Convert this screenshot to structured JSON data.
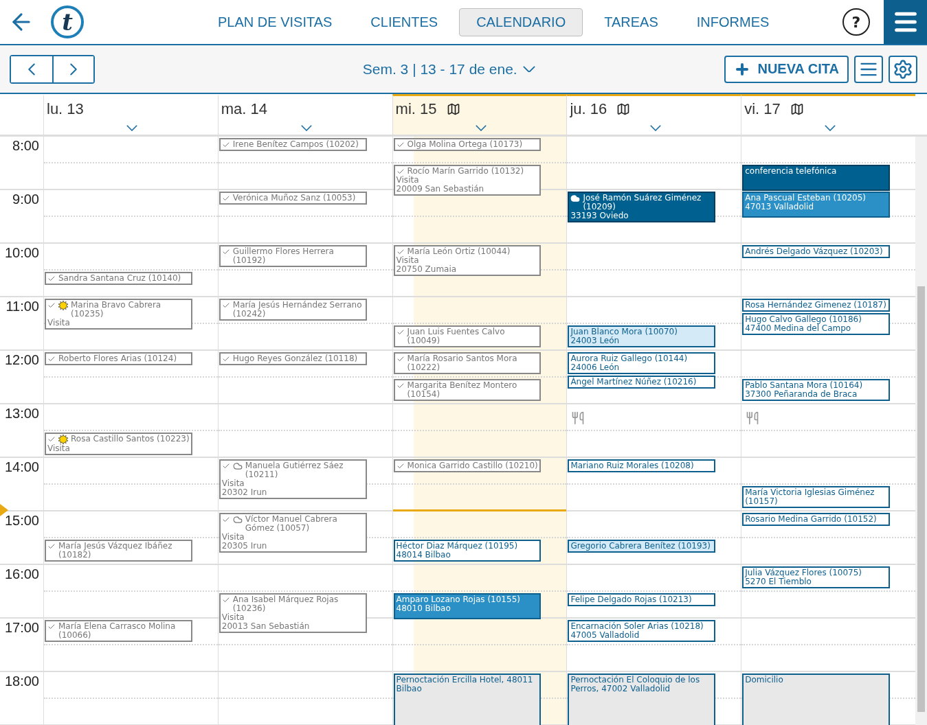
{
  "nav": {
    "logo": "t",
    "help": "?",
    "tabs": [
      {
        "label": "PLAN DE VISITAS",
        "selected": false
      },
      {
        "label": "CLIENTES",
        "selected": false
      },
      {
        "label": "CALENDARIO",
        "selected": true
      },
      {
        "label": "TAREAS",
        "selected": false
      },
      {
        "label": "INFORMES",
        "selected": false
      }
    ]
  },
  "toolbar": {
    "week": "Sem. 3 | 13 - 17 de ene.",
    "new_button": "NUEVA CITA"
  },
  "calendar": {
    "hours": [
      {
        "label": "8:00",
        "now": false
      },
      {
        "label": "9:00",
        "now": false
      },
      {
        "label": "10:00",
        "now": false
      },
      {
        "label": "11:00",
        "now": false
      },
      {
        "label": "12:00",
        "now": false
      },
      {
        "label": "13:00",
        "now": false
      },
      {
        "label": "14:00",
        "now": true
      },
      {
        "label": "15:00",
        "now": false
      },
      {
        "label": "16:00",
        "now": false
      },
      {
        "label": "17:00",
        "now": false
      },
      {
        "label": "18:00",
        "now": false
      }
    ],
    "days": [
      {
        "label": "lu. 13",
        "today": false,
        "marked": false,
        "slots": [
          {
            "now": false
          },
          {
            "now": false
          },
          {
            "now": false
          },
          {
            "now": false
          },
          {
            "now": false
          },
          {
            "now": false,
            "events": [
              {
                "kind": "done",
                "title": "Sandra Santana Cruz (10140)"
              }
            ]
          },
          {
            "now": false,
            "events": [
              {
                "kind": "done",
                "weather": {
                  "kind": "sun"
                },
                "title": "Marina Bravo Cabrera (10235)",
                "details": [
                  "Visita"
                ]
              }
            ]
          },
          {
            "now": false
          },
          {
            "now": false,
            "events": [
              {
                "kind": "done",
                "title": "Roberto Flores Arias (10124)"
              }
            ]
          },
          {
            "now": false
          },
          {
            "now": false
          },
          {
            "now": false,
            "events": [
              {
                "kind": "done",
                "weather": {
                  "kind": "sun"
                },
                "title": "Rosa Castillo Santos (10223)",
                "details": [
                  "Visita"
                ]
              }
            ]
          },
          {
            "now": false
          },
          {
            "now": false
          },
          {
            "now": false
          },
          {
            "now": false,
            "events": [
              {
                "kind": "done",
                "title": "María Jesús Vázquez Ibáñez (10182)"
              }
            ]
          },
          {
            "now": false
          },
          {
            "now": false
          },
          {
            "now": false,
            "events": [
              {
                "kind": "done",
                "title": "María Elena Carrasco Molina (10066)"
              }
            ]
          },
          {
            "now": false
          },
          {
            "now": false
          },
          {
            "now": false
          }
        ]
      },
      {
        "label": "ma. 14",
        "today": false,
        "marked": false,
        "slots": [
          {
            "now": false,
            "events": [
              {
                "kind": "done",
                "title": "Irene Benítez Campos (10202)"
              }
            ]
          },
          {
            "now": false
          },
          {
            "now": false,
            "events": [
              {
                "kind": "done",
                "title": "Verónica Muñoz Sanz (10053)"
              }
            ]
          },
          {
            "now": false
          },
          {
            "now": false,
            "events": [
              {
                "kind": "done",
                "title": "Guillermo Flores Herrera (10192)"
              }
            ]
          },
          {
            "now": false
          },
          {
            "now": false,
            "events": [
              {
                "kind": "done",
                "title": "María Jesús Hernández Serrano (10242)"
              }
            ]
          },
          {
            "now": false
          },
          {
            "now": false,
            "events": [
              {
                "kind": "done",
                "title": "Hugo Reyes González (10118)"
              }
            ]
          },
          {
            "now": false
          },
          {
            "now": false
          },
          {
            "now": false
          },
          {
            "now": false,
            "events": [
              {
                "kind": "done",
                "weather": {
                  "kind": "cloud"
                },
                "title": "Manuela Gutiérrez Sáez (10211)",
                "details": [
                  "Visita",
                  "20302 Irun"
                ]
              }
            ]
          },
          {
            "now": false
          },
          {
            "now": false,
            "events": [
              {
                "kind": "done",
                "weather": {
                  "kind": "cloud"
                },
                "title": "Víctor Manuel Cabrera Gómez (10057)",
                "details": [
                  "Visita",
                  "20305 Irun"
                ]
              }
            ]
          },
          {
            "now": false
          },
          {
            "now": false
          },
          {
            "now": false,
            "events": [
              {
                "kind": "done",
                "title": "Ana Isabel Márquez Rojas (10236)",
                "details": [
                  "Visita",
                  "20013 San Sebastián"
                ]
              }
            ]
          },
          {
            "now": false
          },
          {
            "now": false
          },
          {
            "now": false
          },
          {
            "now": false
          }
        ]
      },
      {
        "label": "mi. 15",
        "today": true,
        "marked": true,
        "slots": [
          {
            "now": false,
            "events": [
              {
                "kind": "done",
                "title": "Olga Molina Ortega (10173)"
              }
            ]
          },
          {
            "now": false,
            "events": [
              {
                "kind": "done",
                "title": "Rocío Marín Garrido (10132)",
                "details": [
                  "Visita",
                  "20009 San Sebastián"
                ]
              }
            ]
          },
          {
            "now": false
          },
          {
            "now": false
          },
          {
            "now": false,
            "events": [
              {
                "kind": "done",
                "title": "María León Ortiz (10044)",
                "details": [
                  "Visita",
                  "20750 Zumaia"
                ]
              }
            ]
          },
          {
            "now": false
          },
          {
            "now": false
          },
          {
            "now": false,
            "events": [
              {
                "kind": "done",
                "title": "Juan Luis Fuentes Calvo (10049)"
              }
            ]
          },
          {
            "now": false,
            "events": [
              {
                "kind": "done",
                "title": "María Rosario Santos Mora (10222)"
              }
            ]
          },
          {
            "now": false,
            "events": [
              {
                "kind": "done",
                "title": "Margarita Benítez Montero (10154)"
              }
            ]
          },
          {
            "now": false
          },
          {
            "now": false
          },
          {
            "now": false,
            "events": [
              {
                "kind": "done",
                "title": "Monica Garrido Castillo (10210)"
              }
            ]
          },
          {
            "now": true
          },
          {
            "now": false
          },
          {
            "now": false,
            "events": [
              {
                "kind": "open",
                "title": "Héctor Diaz Márquez (10195)",
                "details": [
                  "48014 Bilbao"
                ]
              }
            ]
          },
          {
            "now": false
          },
          {
            "now": false,
            "events": [
              {
                "kind": "confirmed",
                "title": "Amparo Lozano Rojas (10155)",
                "details": [
                  "48010 Bilbao"
                ]
              }
            ]
          },
          {
            "now": false
          },
          {
            "now": false
          },
          {
            "now": false,
            "events": [
              {
                "kind": "overnight",
                "title": "Pernoctación Ercilla Hotel, 48011 Bilbao"
              }
            ]
          },
          {
            "now": false
          }
        ]
      },
      {
        "label": "ju. 16",
        "today": false,
        "marked": true,
        "slots": [
          {
            "now": false
          },
          {
            "now": false
          },
          {
            "now": false,
            "events": [
              {
                "kind": "dark",
                "weather": {
                  "kind": "cloud"
                },
                "title": "José Ramón Suárez Giménez (10209)",
                "details": [
                  "33193 Oviedo"
                ]
              }
            ]
          },
          {
            "now": false
          },
          {
            "now": false
          },
          {
            "now": false
          },
          {
            "now": false
          },
          {
            "now": false,
            "events": [
              {
                "kind": "highlighted",
                "title": "Juan Blanco Mora (10070)",
                "details": [
                  "24003 León"
                ]
              }
            ]
          },
          {
            "now": false,
            "events": [
              {
                "kind": "open",
                "title": "Aurora Ruiz Gallego (10144)",
                "details": [
                  "24006 León"
                ]
              },
              {
                "kind": "open",
                "title": "Ángel Martínez Núñez (10216)"
              }
            ]
          },
          {
            "now": false
          },
          {
            "now": false,
            "events": [
              {
                "kind": "lunch"
              }
            ]
          },
          {
            "now": false
          },
          {
            "now": false,
            "events": [
              {
                "kind": "open",
                "title": "Mariano Ruiz Morales (10208)"
              }
            ]
          },
          {
            "now": false
          },
          {
            "now": false
          },
          {
            "now": false,
            "events": [
              {
                "kind": "highlighted",
                "title": "Gregorio Cabrera Benítez (10193)"
              }
            ]
          },
          {
            "now": false
          },
          {
            "now": false,
            "events": [
              {
                "kind": "open",
                "title": "Felipe Delgado Rojas (10213)"
              }
            ]
          },
          {
            "now": false,
            "events": [
              {
                "kind": "open",
                "title": "Encarnación Soler Arias (10218)",
                "details": [
                  "47005 Valladolid"
                ]
              }
            ]
          },
          {
            "now": false
          },
          {
            "now": false,
            "events": [
              {
                "kind": "overnight",
                "title": "Pernoctación El Coloquio de los Perros, 47002 Valladolid"
              }
            ]
          },
          {
            "now": false
          }
        ]
      },
      {
        "label": "vi. 17",
        "today": false,
        "marked": true,
        "slots": [
          {
            "now": false
          },
          {
            "now": false,
            "events": [
              {
                "kind": "dark",
                "title": "conferencia telefónica"
              }
            ]
          },
          {
            "now": false,
            "events": [
              {
                "kind": "confirmed",
                "title": "Ana Pascual Esteban (10205)",
                "details": [
                  "47013 Valladolid"
                ]
              }
            ]
          },
          {
            "now": false
          },
          {
            "now": false,
            "events": [
              {
                "kind": "open",
                "title": "Andrés Delgado Vázquez (10203)"
              }
            ]
          },
          {
            "now": false
          },
          {
            "now": false,
            "events": [
              {
                "kind": "open",
                "title": "Rosa Hernández Gimenez (10187)"
              },
              {
                "kind": "open",
                "title": "Hugo Calvo Gallego (10186)",
                "details": [
                  "47400 Medina del Campo"
                ]
              }
            ]
          },
          {
            "now": false
          },
          {
            "now": false
          },
          {
            "now": false,
            "events": [
              {
                "kind": "open",
                "title": "Pablo Santana Mora (10164)",
                "details": [
                  "37300 Peñaranda de Braca"
                ]
              }
            ]
          },
          {
            "now": false,
            "events": [
              {
                "kind": "lunch"
              }
            ]
          },
          {
            "now": false
          },
          {
            "now": false
          },
          {
            "now": false,
            "events": [
              {
                "kind": "open",
                "title": "María Victoria Iglesias Giménez (10157)"
              }
            ]
          },
          {
            "now": false,
            "events": [
              {
                "kind": "open",
                "title": "Rosario Medina Garrido (10152)"
              }
            ]
          },
          {
            "now": false
          },
          {
            "now": false,
            "events": [
              {
                "kind": "open",
                "title": "Julia Vázquez Flores (10075)",
                "details": [
                  "5270 El Tiemblo"
                ]
              }
            ]
          },
          {
            "now": false
          },
          {
            "now": false
          },
          {
            "now": false
          },
          {
            "now": false,
            "events": [
              {
                "kind": "overnight",
                "title": "Domicilio"
              }
            ]
          },
          {
            "now": false
          }
        ]
      }
    ]
  }
}
